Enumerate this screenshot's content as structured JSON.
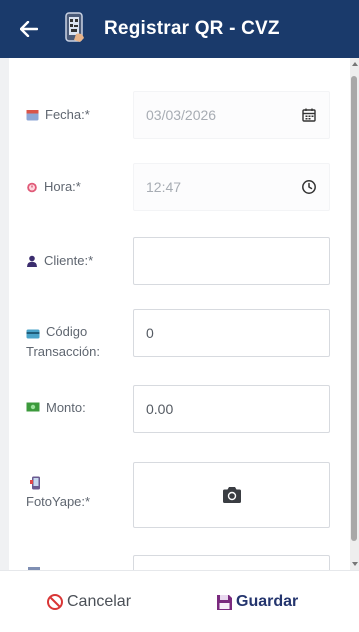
{
  "header": {
    "title": "Registrar QR - CVZ",
    "back_icon": "arrow-left-icon",
    "app_icon": "phone-qr-icon",
    "bg_color": "#1a3a6b"
  },
  "form": {
    "fecha": {
      "label": "Fecha:*",
      "value": "03/03/2026",
      "icon": "calendar-icon"
    },
    "hora": {
      "label": "Hora:*",
      "value": "12:47",
      "icon": "clock-icon"
    },
    "cliente": {
      "label": "Cliente:*",
      "value": ""
    },
    "codigo": {
      "label_line1": "Código",
      "label_line2": "Transacción:",
      "value": "0"
    },
    "monto": {
      "label": "Monto:",
      "value": "0.00"
    },
    "foto": {
      "label": "FotoYape:*",
      "icon": "camera-icon"
    }
  },
  "footer": {
    "cancel_label": "Cancelar",
    "save_label": "Guardar",
    "cancel_color": "#d93636",
    "save_color": "#24356e"
  }
}
